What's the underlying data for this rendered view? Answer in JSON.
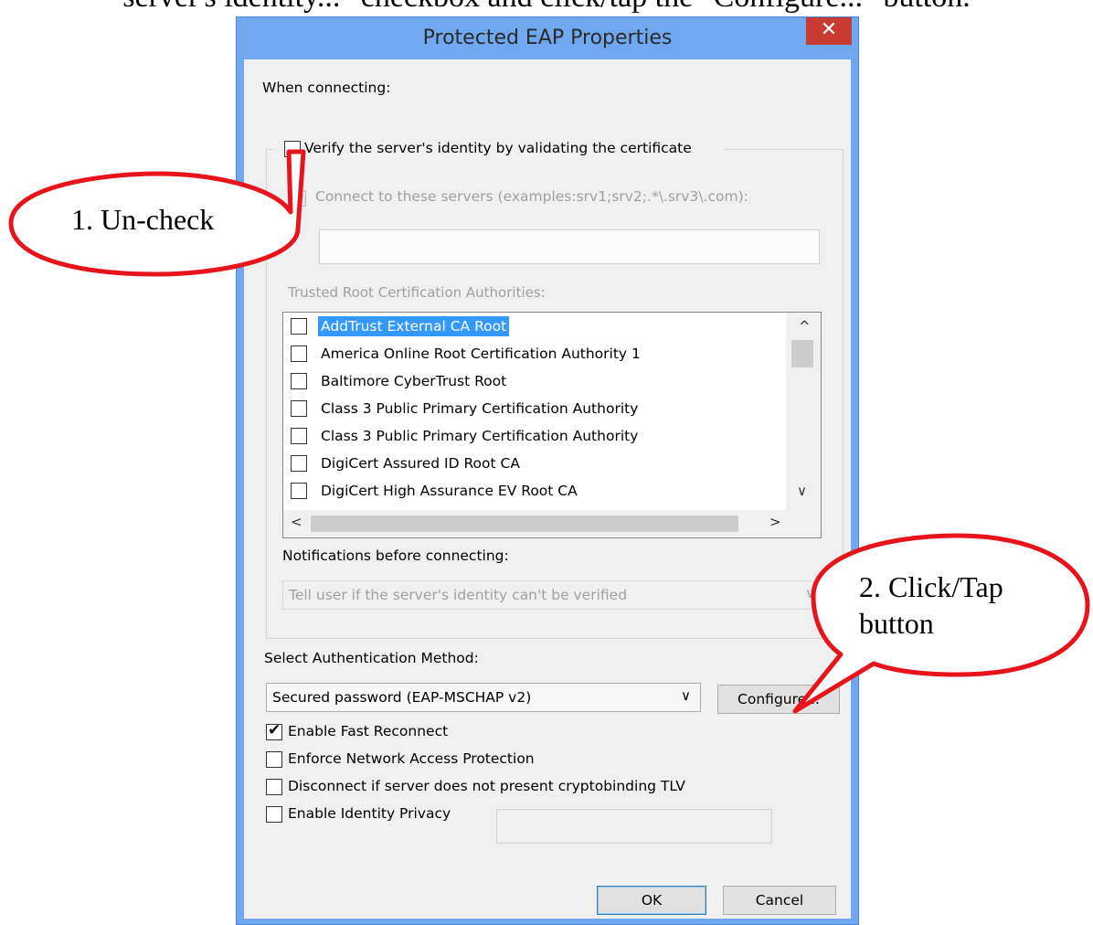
{
  "instruction_fragment": "server's identity...\" checkbox and click/tap the \"Configure...\" button.",
  "window": {
    "title": "Protected EAP Properties",
    "close_glyph": "✕"
  },
  "dialog": {
    "when_connecting": "When connecting:",
    "verify_server": {
      "label": "Verify the server's identity by validating the certificate",
      "checked": false
    },
    "connect_servers": {
      "label": "Connect to these servers (examples:srv1;srv2;.*\\.srv3\\.com):",
      "checked": false,
      "value": ""
    },
    "trusted_root_label": "Trusted Root Certification Authorities:",
    "ca_list": [
      {
        "name": "AddTrust External CA Root",
        "selected": true
      },
      {
        "name": "America Online Root Certification Authority 1",
        "selected": false
      },
      {
        "name": "Baltimore CyberTrust Root",
        "selected": false
      },
      {
        "name": "Class 3 Public Primary Certification Authority",
        "selected": false
      },
      {
        "name": "Class 3 Public Primary Certification Authority",
        "selected": false
      },
      {
        "name": "DigiCert Assured ID Root CA",
        "selected": false
      },
      {
        "name": "DigiCert High Assurance EV Root CA",
        "selected": false
      }
    ],
    "notifications_label": "Notifications before connecting:",
    "notifications_value": "Tell user if the server's identity can't be verified",
    "auth_method_label": "Select Authentication Method:",
    "auth_method_value": "Secured password (EAP-MSCHAP v2)",
    "configure_label": "Configure...",
    "options": [
      {
        "label": "Enable Fast Reconnect",
        "checked": true
      },
      {
        "label": "Enforce Network Access Protection",
        "checked": false
      },
      {
        "label": "Disconnect if server does not present cryptobinding TLV",
        "checked": false
      },
      {
        "label": "Enable Identity Privacy",
        "checked": false
      }
    ],
    "identity_privacy_value": "",
    "ok_label": "OK",
    "cancel_label": "Cancel"
  },
  "callouts": {
    "uncheck": "1. Un-check",
    "click_line1": "2. Click/Tap",
    "click_line2": "button"
  },
  "colors": {
    "callout_border": "#e8141c",
    "selection": "#3399ff",
    "titlebar": "#6fa8ef",
    "close": "#c83b33"
  },
  "icons": {
    "check": "✔",
    "chevron_down": "∨",
    "arrow_up": "^",
    "arrow_down": "∨",
    "arrow_left": "<",
    "arrow_right": ">"
  }
}
